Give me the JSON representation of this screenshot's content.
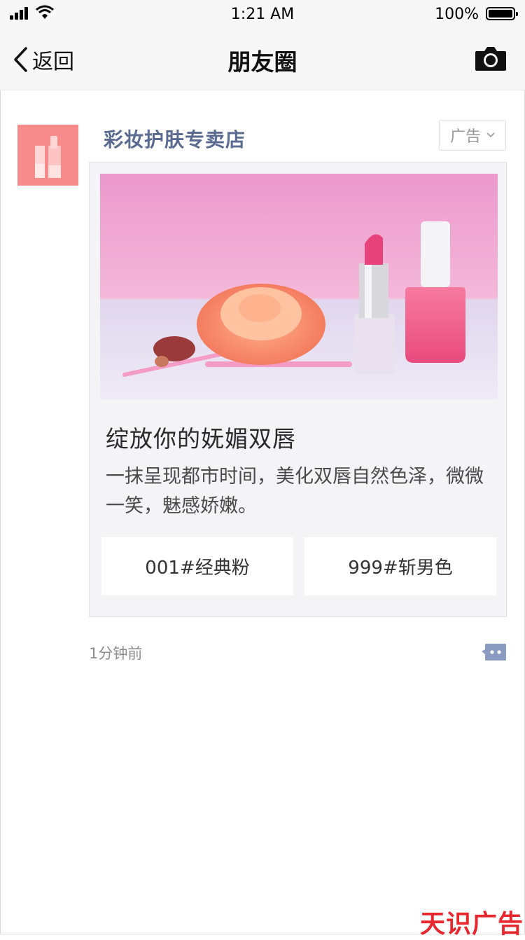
{
  "status_bar": {
    "time": "1:21 AM",
    "battery": "100%",
    "battery_level": 1.0
  },
  "nav": {
    "back_label": "返回",
    "title": "朋友圈"
  },
  "post": {
    "author": "彩妆护肤专卖店",
    "ad_label": "广告",
    "title": "绽放你的妩媚双唇",
    "description": "一抹呈现都市时间，美化双唇自然色泽，微微一笑，魅感娇嫩。",
    "options": [
      "001#经典粉",
      "999#斩男色"
    ],
    "time_ago": "1分钟前"
  },
  "watermark": "天识广告",
  "colors": {
    "author": "#5b6a91",
    "avatar": "#f78a8a",
    "watermark": "#e8262e"
  },
  "icons": [
    "back-chevron-icon",
    "camera-icon",
    "comment-icon",
    "lipstick-icon"
  ]
}
